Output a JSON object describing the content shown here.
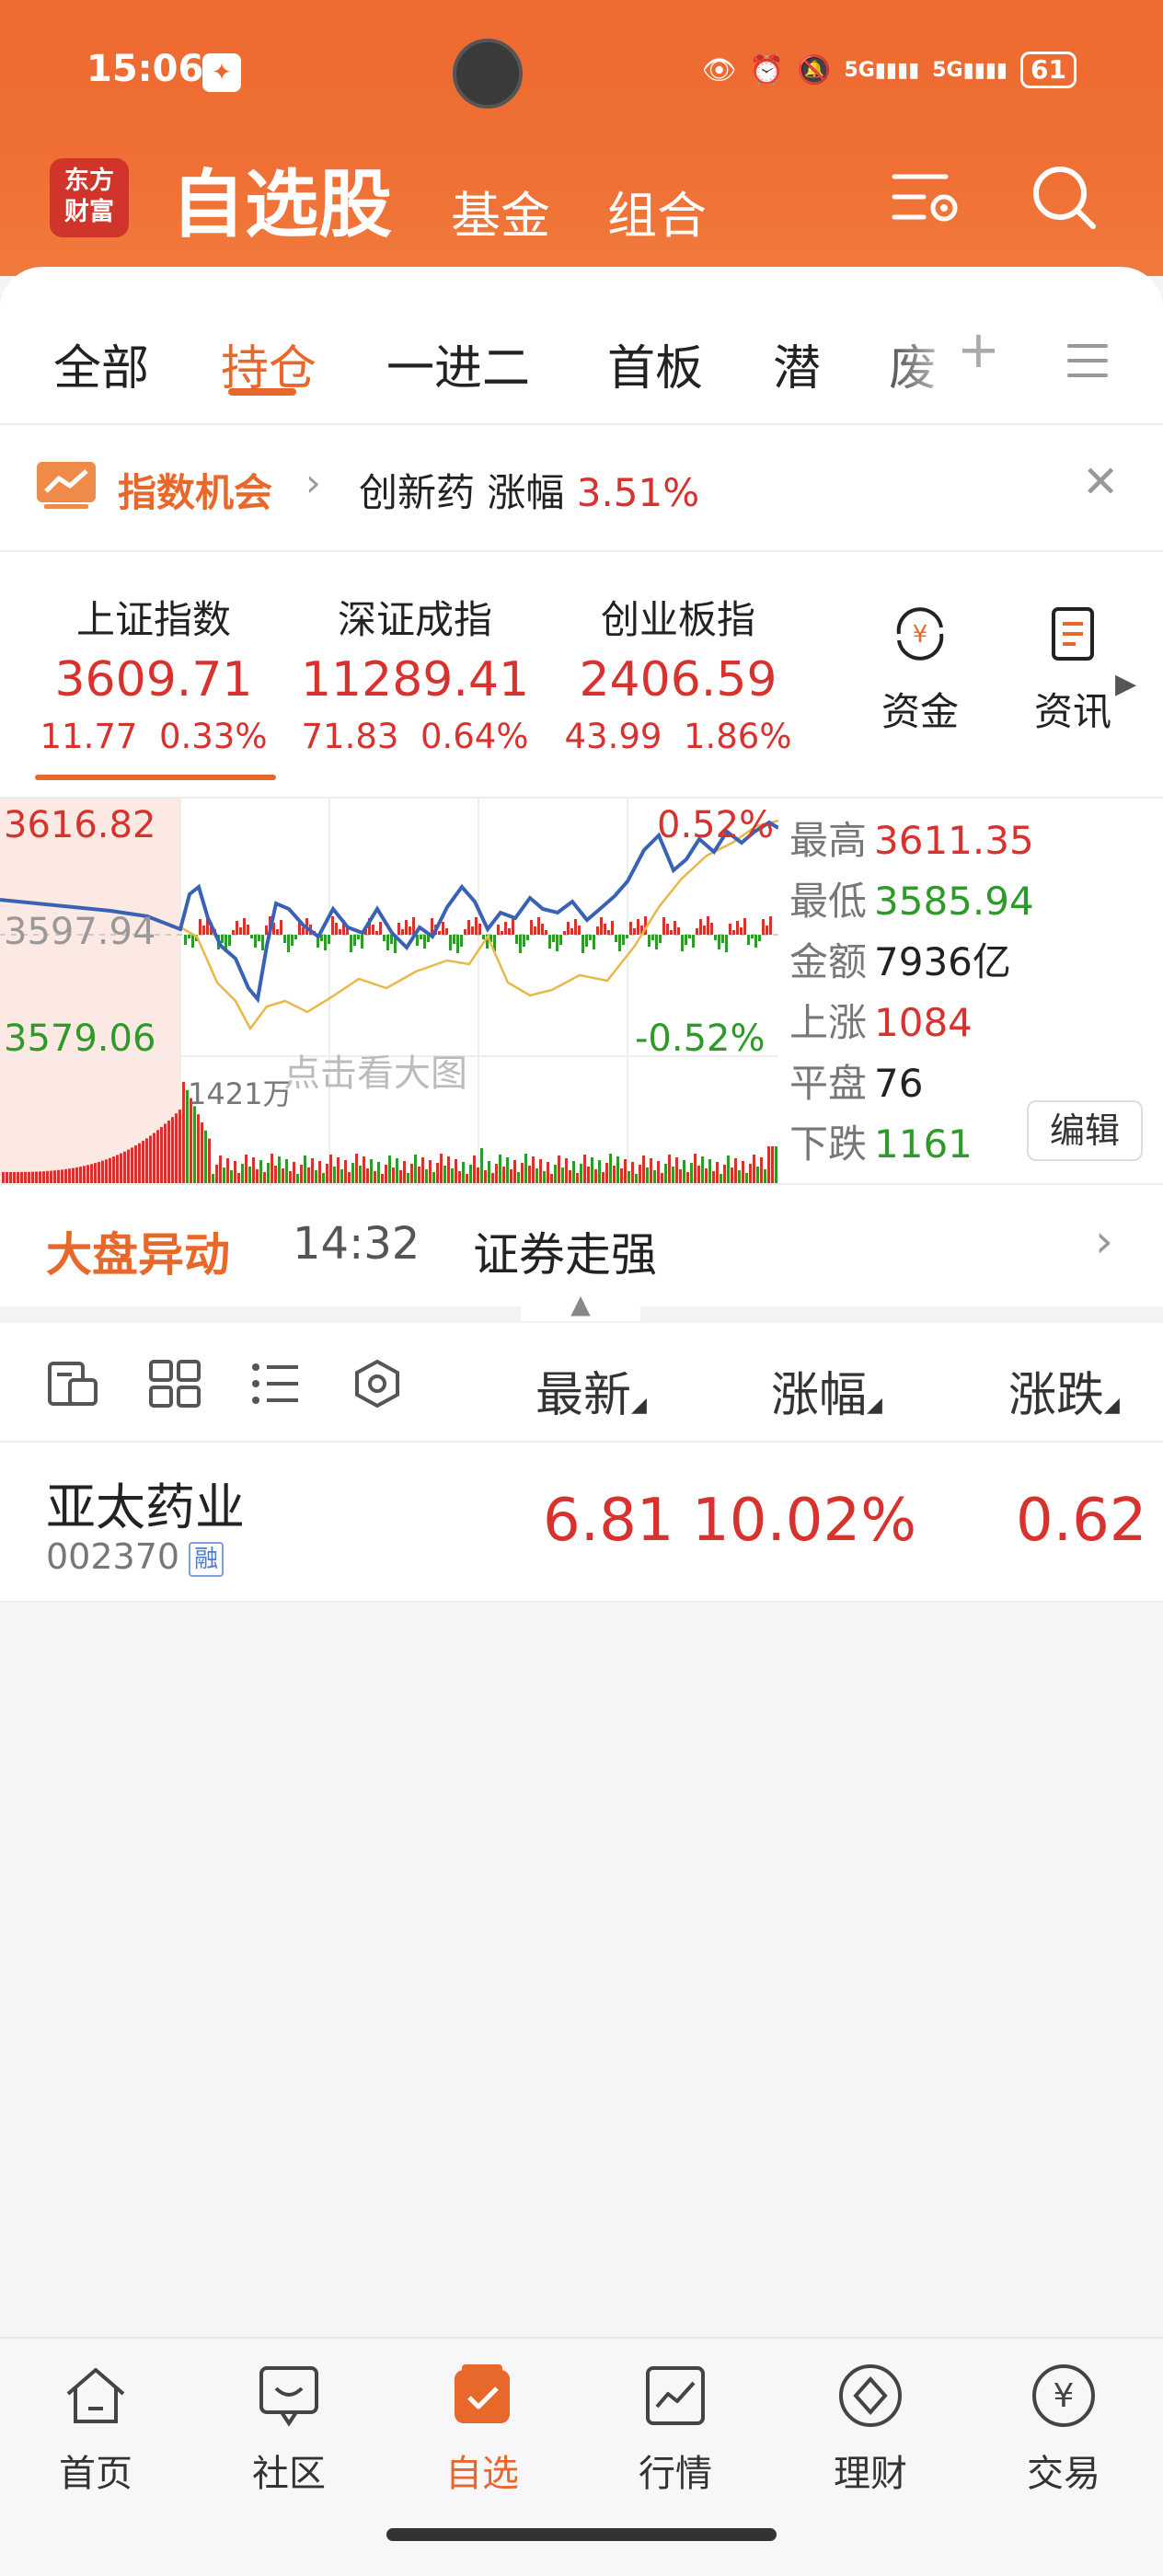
{
  "status_bar": {
    "time": "15:06",
    "battery": "61"
  },
  "header": {
    "logo_line1": "东方",
    "logo_line2": "财富",
    "title": "自选股",
    "tabs": [
      "基金",
      "组合"
    ]
  },
  "group_tabs": [
    "全部",
    "持仓",
    "一进二",
    "首板",
    "潜",
    "废"
  ],
  "active_group_tab": "持仓",
  "banner": {
    "title": "指数机会",
    "text_prefix": "创新药 涨幅",
    "text_value": "3.51%"
  },
  "indices": [
    {
      "name": "上证指数",
      "value": "3609.71",
      "change": "11.77",
      "pct": "0.33%"
    },
    {
      "name": "深证成指",
      "value": "11289.41",
      "change": "71.83",
      "pct": "0.64%"
    },
    {
      "name": "创业板指",
      "value": "2406.59",
      "change": "43.99",
      "pct": "1.86%"
    }
  ],
  "side_buttons": {
    "funds": "资金",
    "news": "资讯"
  },
  "chart_labels": {
    "top_left": "3616.82",
    "mid_left": "3597.94",
    "bottom_left": "3579.06",
    "top_right": "0.52%",
    "bottom_right": "-0.52%",
    "volume": "1421万",
    "hint": "点击看大图"
  },
  "stats": {
    "high_label": "最高",
    "high": "3611.35",
    "low_label": "最低",
    "low": "3585.94",
    "amount_label": "金额",
    "amount": "7936亿",
    "up_label": "上涨",
    "up": "1084",
    "flat_label": "平盘",
    "flat": "76",
    "down_label": "下跌",
    "down": "1161",
    "edit": "编辑"
  },
  "market_move": {
    "title": "大盘异动",
    "time": "14:32",
    "text": "证券走强"
  },
  "list_columns": {
    "latest": "最新",
    "pct": "涨幅",
    "change": "涨跌"
  },
  "stocks": [
    {
      "name": "亚太药业",
      "code": "002370",
      "tag": "融",
      "latest": "6.81",
      "pct": "10.02%",
      "change": "0.62"
    }
  ],
  "bottom_nav": [
    "首页",
    "社区",
    "自选",
    "行情",
    "理财",
    "交易"
  ],
  "active_nav": "自选",
  "colors": {
    "accent": "#e8682b",
    "up": "#d8322f",
    "down": "#2d9a2a",
    "index_line": "#3a62b4",
    "avg_line": "#e8b84a"
  }
}
